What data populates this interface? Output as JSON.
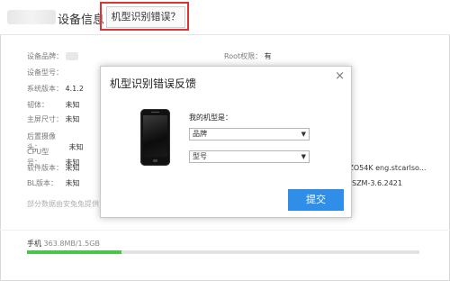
{
  "header": {
    "title": "设备信息",
    "misid_button": "机型识别错误？"
  },
  "device_info": {
    "brand_label": "设备品牌：",
    "model_label": "设备型号：",
    "system_label": "系统版本：",
    "system_value": "4.1.2",
    "baseband_label": "韧体：",
    "baseband_value": "未知",
    "screen_label": "主屏尺寸：",
    "screen_value": "未知",
    "camera_label": "后置摄像头：",
    "camera_value": "未知",
    "cpu_label": "CPU型号：",
    "cpu_value": "未知",
    "software_label": "软件版本：",
    "software_value": "未知",
    "bl_label": "BL版本：",
    "bl_value": "未知",
    "root_label": "Root权限：",
    "root_value": "有",
    "build_value": "JZO54K eng.stcarlso...",
    "kernel_value": "NSZM-3.6.2421",
    "partial_note": "部分数据由安兔兔提供"
  },
  "storage": {
    "label": "手机",
    "value": "363.8MB/1.5GB",
    "fraction": 0.24
  },
  "dialog": {
    "title": "机型识别错误反馈",
    "question": "我的机型是：",
    "brand_select": "品牌",
    "model_select": "型号",
    "submit": "提交",
    "close": "×"
  },
  "colors": {
    "accent": "#2e8ee8",
    "highlight": "#e03232",
    "progress": "#4cc34c"
  }
}
